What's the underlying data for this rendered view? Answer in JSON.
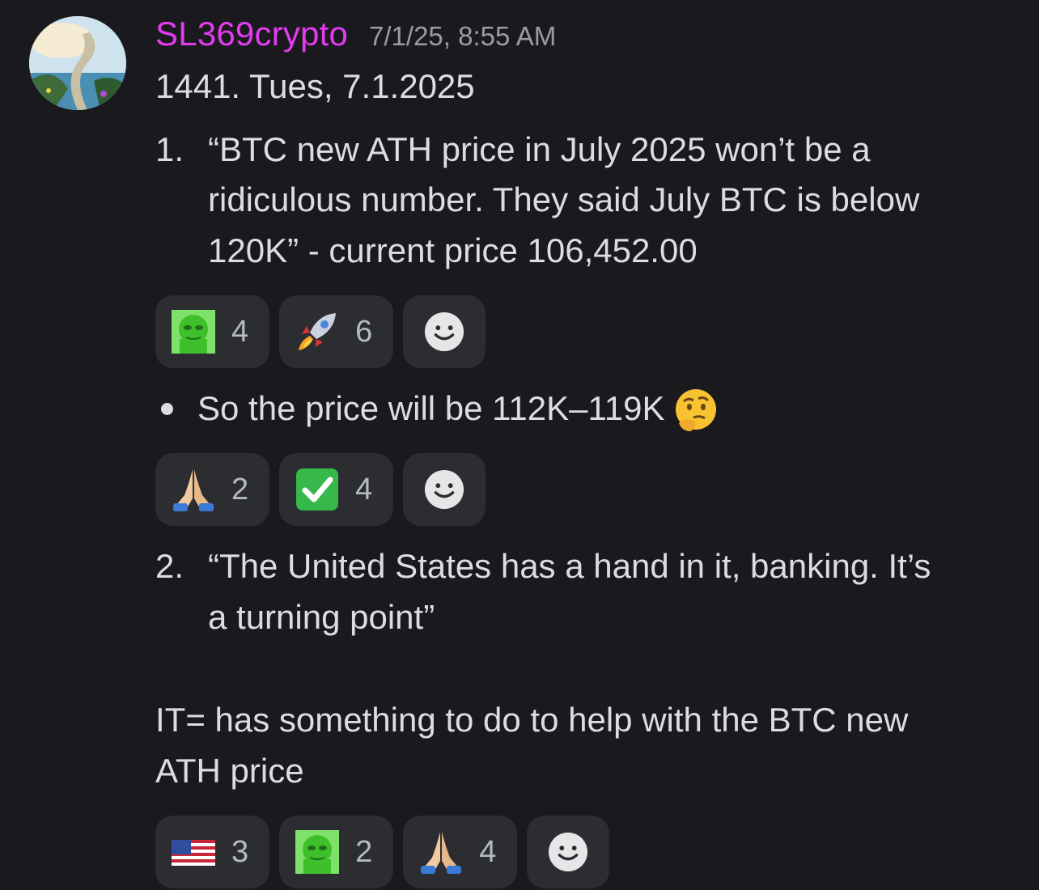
{
  "message": {
    "username": "SL369crypto",
    "timestamp": "7/1/25, 8:55 AM",
    "title": "1441.  Tues, 7.1.2025",
    "item1": {
      "number": "1.",
      "lines": [
        "“BTC new ATH price in July 2025 won’t be a",
        "ridiculous number. They said July BTC is below",
        "120K” - current price 106,452.00"
      ]
    },
    "bullet": "So the price will be 112K–119K",
    "item2": {
      "number": "2.",
      "lines": [
        "“The United States has a hand in it, banking. It’s",
        "a turning point”"
      ]
    },
    "note_lines": [
      "IT= has something to do to help with the BTC new",
      "ATH price"
    ]
  },
  "reactions_1": [
    {
      "icon": "pepe-face-icon",
      "count": "4"
    },
    {
      "icon": "rocket-icon",
      "count": "6"
    }
  ],
  "reactions_2": [
    {
      "icon": "praying-hands-icon",
      "count": "2"
    },
    {
      "icon": "check-mark-icon",
      "count": "4"
    }
  ],
  "reactions_3": [
    {
      "icon": "us-flag-icon",
      "count": "3"
    },
    {
      "icon": "pepe-face-icon",
      "count": "2"
    },
    {
      "icon": "praying-hands-icon",
      "count": "4"
    }
  ],
  "add_reaction_icon": "smiley-add-reaction-icon",
  "colors": {
    "background": "#1a1a1e",
    "username": "#e23bf0",
    "reaction_bg": "#2b2d31",
    "text": "#dbdee1"
  }
}
